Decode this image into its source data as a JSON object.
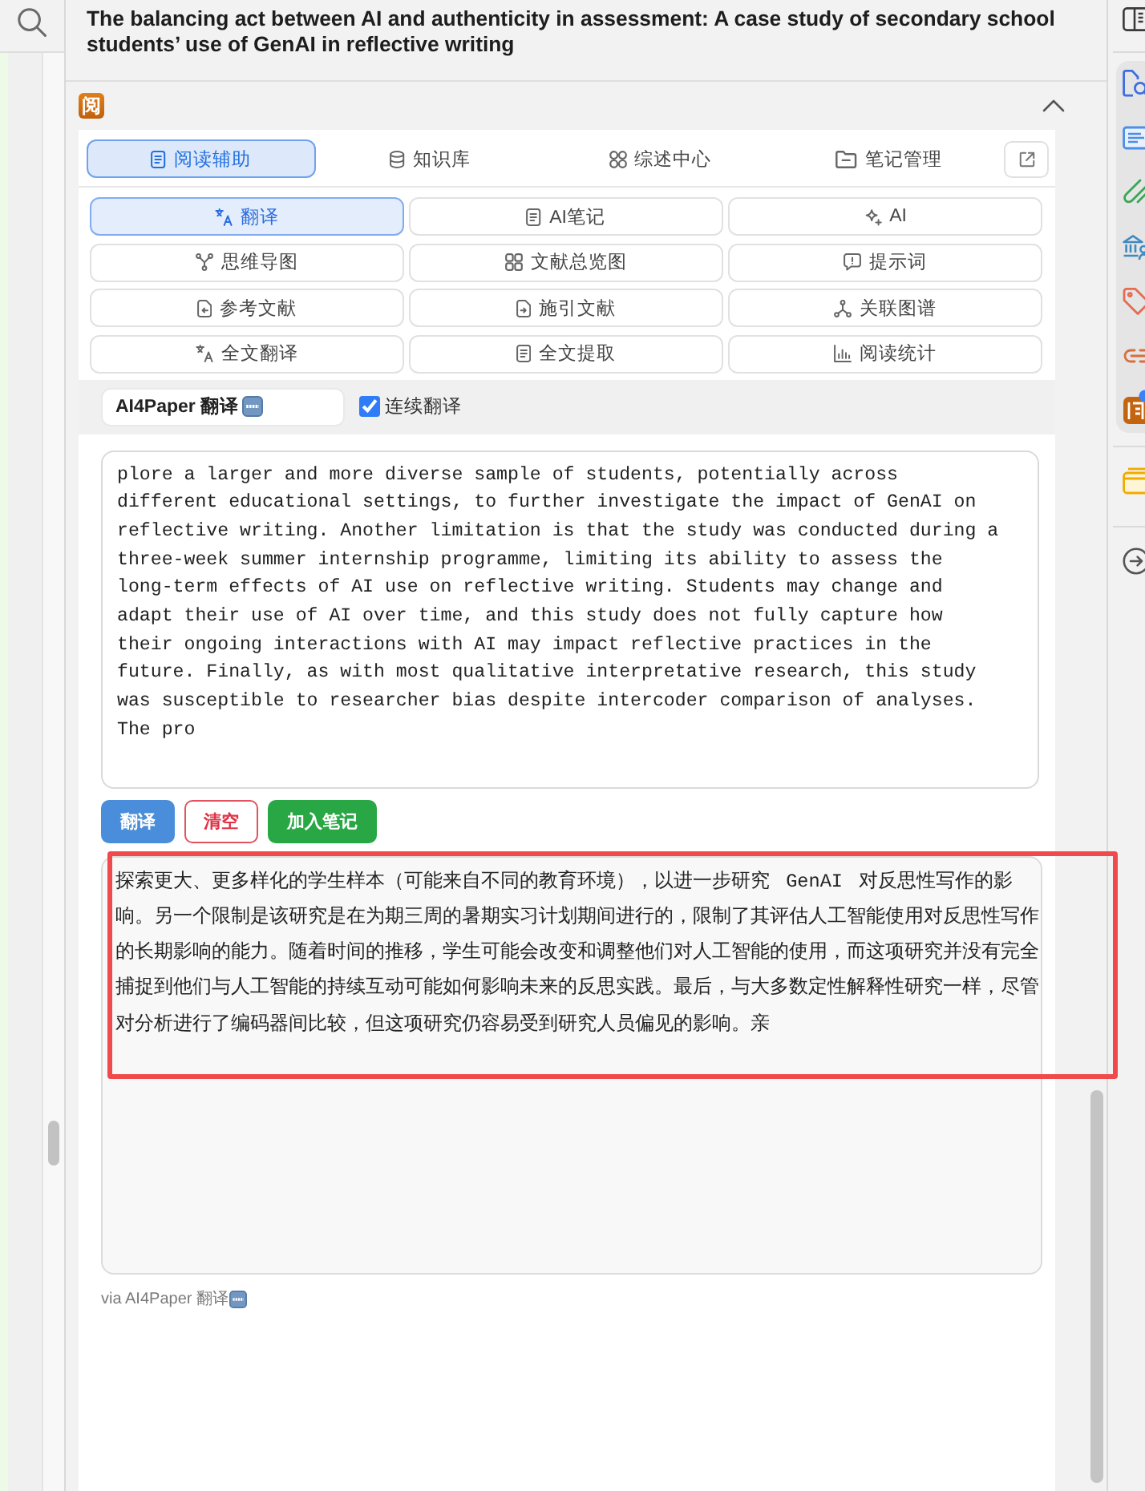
{
  "document": {
    "title": "The balancing act between AI and authenticity in assessment: A case study of secondary school students’ use of GenAI in reflective writing"
  },
  "section": {
    "badge": "阅",
    "expanded": true
  },
  "tabs": [
    {
      "label": "阅读辅助",
      "selected": true
    },
    {
      "label": "知识库",
      "selected": false
    },
    {
      "label": "综述中心",
      "selected": false
    },
    {
      "label": "笔记管理",
      "selected": false
    }
  ],
  "tools": [
    {
      "label": "翻译",
      "selected": true
    },
    {
      "label": "AI笔记",
      "selected": false
    },
    {
      "label": "AI",
      "selected": false
    },
    {
      "label": "思维导图",
      "selected": false
    },
    {
      "label": "文献总览图",
      "selected": false
    },
    {
      "label": "提示词",
      "selected": false
    },
    {
      "label": "参考文献",
      "selected": false
    },
    {
      "label": "施引文献",
      "selected": false
    },
    {
      "label": "关联图谱",
      "selected": false
    },
    {
      "label": "全文翻译",
      "selected": false
    },
    {
      "label": "全文提取",
      "selected": false
    },
    {
      "label": "阅读统计",
      "selected": false
    }
  ],
  "translator": {
    "engine": "AI4Paper 翻译",
    "continuous": {
      "label": "连续翻译",
      "checked": true
    }
  },
  "source": {
    "value": "plore a larger and more diverse sample of students, potentially across different educational settings, to further investigate the impact of GenAI on reflective writing. Another limitation is that the study was conducted during a three-week summer internship programme, limiting its ability to assess the long-term effects of AI use on reflective writing. Students may change and adapt their use of AI over time, and this study does not fully capture how their ongoing interactions with AI may impact reflective practices in the future. Finally, as with most qualitative interpretative research, this study was susceptible to researcher bias despite intercoder comparison of analyses. The pro"
  },
  "actions": [
    {
      "label": "翻译",
      "kind": "primary"
    },
    {
      "label": "清空",
      "kind": "danger"
    },
    {
      "label": "加入笔记",
      "kind": "success"
    }
  ],
  "result": {
    "text": "探索更大、更多样化的学生样本（可能来自不同的教育环境），以进一步研究 GenAI 对反思性写作的影响。另一个限制是该研究是在为期三周的暑期实习计划期间进行的，限制了其评估人工智能使用对反思性写作的长期影响的能力。随着时间的推移，学生可能会改变和调整他们对人工智能的使用，而这项研究并没有完全捕捉到他们与人工智能的持续互动可能如何影响未来的反思实践。最后，与大多数定性解释性研究一样，尽管对分析进行了编码器间比较，但这项研究仍容易受到研究人员偏见的影响。亲"
  },
  "credit": {
    "text": "via AI4Paper 翻译"
  }
}
